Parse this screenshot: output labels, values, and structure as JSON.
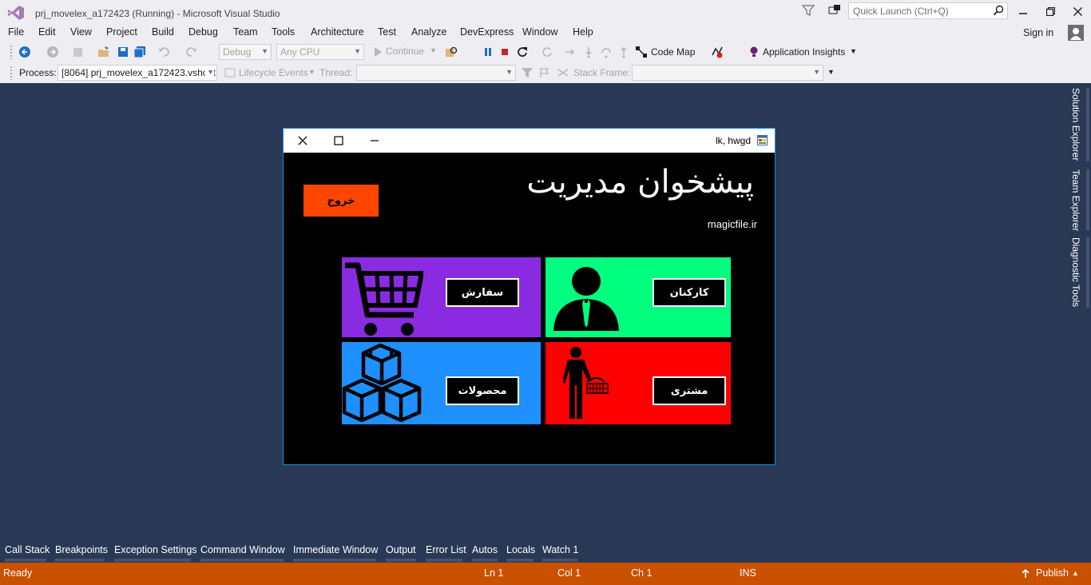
{
  "window": {
    "title": "prj_movelex_a172423 (Running) - Microsoft Visual Studio",
    "quick_launch_placeholder": "Quick Launch (Ctrl+Q)",
    "sign_in": "Sign in"
  },
  "menu": [
    "File",
    "Edit",
    "View",
    "Project",
    "Build",
    "Debug",
    "Team",
    "Tools",
    "Architecture",
    "Test",
    "Analyze",
    "DevExpress",
    "Window",
    "Help"
  ],
  "toolbar1": {
    "config": "Debug",
    "platform": "Any CPU",
    "continue": "Continue",
    "code_map": "Code Map",
    "app_insights": "Application Insights"
  },
  "toolbar2": {
    "process_label": "Process:",
    "process_value": "[8064] prj_movelex_a172423.vshost",
    "lifecycle": "Lifecycle Events",
    "thread_label": "Thread:",
    "stack_label": "Stack Frame:"
  },
  "right_dock": [
    "Solution Explorer",
    "Team Explorer",
    "Diagnostic Tools"
  ],
  "app": {
    "title": "lk, hwgd",
    "heading": "پیشخوان مدیریت",
    "site": "magicfile.ir",
    "exit_label": "خروج",
    "tiles": {
      "orders": {
        "label": "سفارش",
        "color": "#8a2be2"
      },
      "staff": {
        "label": "کارکنان",
        "color": "#00ff7f"
      },
      "products": {
        "label": "محصولات",
        "color": "#1e90ff"
      },
      "customer": {
        "label": "مشتری",
        "color": "#ff0000"
      }
    }
  },
  "bottom_tabs": [
    "Call Stack",
    "Breakpoints",
    "Exception Settings",
    "Command Window",
    "Immediate Window",
    "Output",
    "Error List",
    "Autos",
    "Locals",
    "Watch 1"
  ],
  "status": {
    "state": "Ready",
    "ln": "Ln 1",
    "col": "Col 1",
    "ch": "Ch 1",
    "mode": "INS",
    "publish": "Publish"
  },
  "colors": {
    "accent": "#ca5100",
    "workspace": "#293955"
  }
}
